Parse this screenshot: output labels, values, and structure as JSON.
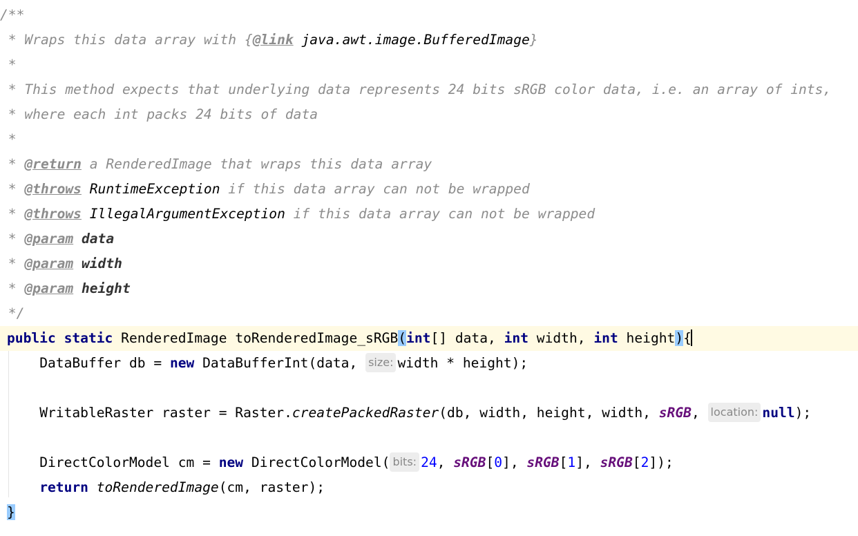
{
  "editor": {
    "comment": {
      "open": "/**",
      "line1_prefix": " * Wraps this data array with ",
      "link_open": "{",
      "link_tag": "@link",
      "link_target": " java.awt.image.BufferedImage",
      "link_close": "}",
      "blank1": " *",
      "desc1": " * This method expects that underlying data represents 24 bits sRGB color data, i.e. an array of ints,",
      "desc2": " * where each int packs 24 bits of data",
      "blank2": " *",
      "return_prefix": " * ",
      "return_tag": "@return",
      "return_text": " a RenderedImage that wraps this data array",
      "throws1_prefix": " * ",
      "throws1_tag": "@throws",
      "throws1_type": " RuntimeException",
      "throws1_text": " if this data array can not be wrapped",
      "throws2_prefix": " * ",
      "throws2_tag": "@throws",
      "throws2_type": " IllegalArgumentException",
      "throws2_text": " if this data array can not be wrapped",
      "param1_prefix": " * ",
      "param1_tag": "@param",
      "param1_name": " data",
      "param2_prefix": " * ",
      "param2_tag": "@param",
      "param2_name": " width",
      "param3_prefix": " * ",
      "param3_tag": "@param",
      "param3_name": " height",
      "close": " */"
    },
    "signature": {
      "kw_public": "public",
      "kw_static": "static",
      "return_type": "RenderedImage",
      "method_name": "toRenderedImage_sRGB",
      "open_paren": "(",
      "kw_int1": "int",
      "p1": "[] data, ",
      "kw_int2": "int",
      "p2": " width, ",
      "kw_int3": "int",
      "p3": " height",
      "close_paren": ")",
      "open_brace": "{"
    },
    "line_db": {
      "indent": "    ",
      "text1": "DataBuffer db = ",
      "kw_new": "new",
      "text2": " DataBufferInt(data, ",
      "hint": "size:",
      "text3": "width * height);"
    },
    "line_raster": {
      "indent": "    ",
      "text1": "WritableRaster raster = Raster.",
      "method": "createPackedRaster",
      "text2": "(db, width, height, width, ",
      "static_field": "sRGB",
      "text3": ", ",
      "hint": "location:",
      "kw_null": "null",
      "text4": ");"
    },
    "line_cm": {
      "indent": "    ",
      "text1": "DirectColorModel cm = ",
      "kw_new": "new",
      "text2": " DirectColorModel(",
      "hint": "bits:",
      "num24": "24",
      "sep1": ", ",
      "f1": "sRGB",
      "b1o": "[",
      "i0": "0",
      "b1c": "], ",
      "f2": "sRGB",
      "b2o": "[",
      "i1": "1",
      "b2c": "], ",
      "f3": "sRGB",
      "b3o": "[",
      "i2": "2",
      "b3c": "]);"
    },
    "line_return": {
      "indent": "    ",
      "kw_return": "return",
      "sp": " ",
      "method": "toRenderedImage",
      "args": "(cm, raster);"
    },
    "close_brace": "}"
  }
}
